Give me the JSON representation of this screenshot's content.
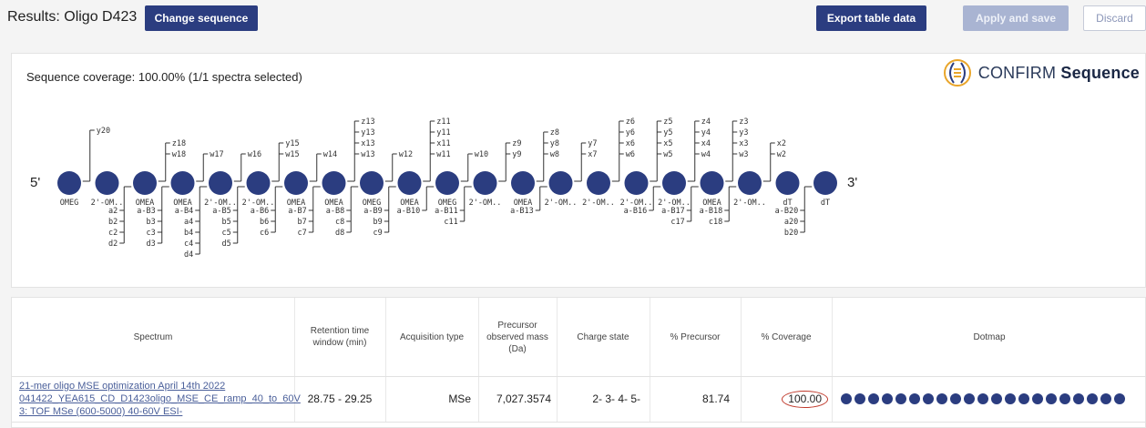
{
  "header": {
    "title": "Results: Oligo D423",
    "change_sequence": "Change sequence",
    "export": "Export table data",
    "apply": "Apply and save",
    "discard": "Discard"
  },
  "coverage": {
    "title": "Sequence coverage: 100.00% (1/1 spectra selected)",
    "brand_a": "CONFIRM",
    "brand_b": "Sequence",
    "end5": "5'",
    "end3": "3'",
    "nucleotides": [
      "OMEG",
      "2'-OM..",
      "OMEA",
      "OMEA",
      "2'-OM..",
      "2'-OM..",
      "OMEA",
      "OMEA",
      "OMEG",
      "OMEA",
      "OMEG",
      "2'-OM..",
      "OMEA",
      "2'-OM..",
      "2'-OM..",
      "2'-OM..",
      "2'-OM..",
      "OMEA",
      "2'-OM..",
      "dT",
      "dT"
    ],
    "upper_labels": [
      [
        "y20"
      ],
      [
        "z18",
        "w18"
      ],
      [
        "w17"
      ],
      [
        "w16"
      ],
      [
        "y15",
        "w15"
      ],
      [
        "w14"
      ],
      [
        "z13",
        "y13",
        "x13",
        "w13"
      ],
      [
        "w12"
      ],
      [
        "z11",
        "y11",
        "x11",
        "w11"
      ],
      [
        "w10"
      ],
      [
        "z9",
        "y9"
      ],
      [
        "z8",
        "y8",
        "w8"
      ],
      [
        "y7",
        "x7"
      ],
      [
        "z6",
        "y6",
        "x6",
        "w6"
      ],
      [
        "z5",
        "y5",
        "x5",
        "w5"
      ],
      [
        "z4",
        "y4",
        "x4",
        "w4"
      ],
      [
        "z3",
        "y3",
        "x3",
        "w3"
      ],
      [
        "x2",
        "w2"
      ]
    ],
    "lower_labels": [
      [
        "a2",
        "b2",
        "c2",
        "d2"
      ],
      [
        "a-B3",
        "b3",
        "c3",
        "d3"
      ],
      [
        "a-B4",
        "a4",
        "b4",
        "c4",
        "d4"
      ],
      [
        "a-B5",
        "b5",
        "c5",
        "d5"
      ],
      [
        "a-B6",
        "b6",
        "c6"
      ],
      [
        "a-B7",
        "b7",
        "c7"
      ],
      [
        "a-B8",
        "c8",
        "d8"
      ],
      [
        "a-B9",
        "b9",
        "c9"
      ],
      [
        "a-B10"
      ],
      [
        "a-B11",
        "c11"
      ],
      [
        "a-B13"
      ],
      [
        "a-B16"
      ],
      [
        "a-B17",
        "c17"
      ],
      [
        "a-B18",
        "c18"
      ],
      [
        "a-B20",
        "a20",
        "b20"
      ]
    ]
  },
  "table": {
    "headers": [
      "Spectrum",
      "Retention time window (min)",
      "Acquisition type",
      "Precursor observed mass (Da)",
      "Charge state",
      "% Precursor",
      "% Coverage",
      "Dotmap"
    ],
    "row": {
      "spectrum": "21-mer oligo MSE optimization April 14th 2022 041422_YEA615_CD_D1423oligo_MSE_CE_ramp_40_to_60V 3: TOF MSe (600-5000) 40-60V ESI-",
      "retention": "28.75 - 29.25",
      "acquisition": "MSe",
      "mass": "7,027.3574",
      "charge": "2- 3- 4- 5-",
      "precursor": "81.74",
      "coverage": "100.00",
      "dot_count": 21
    }
  }
}
